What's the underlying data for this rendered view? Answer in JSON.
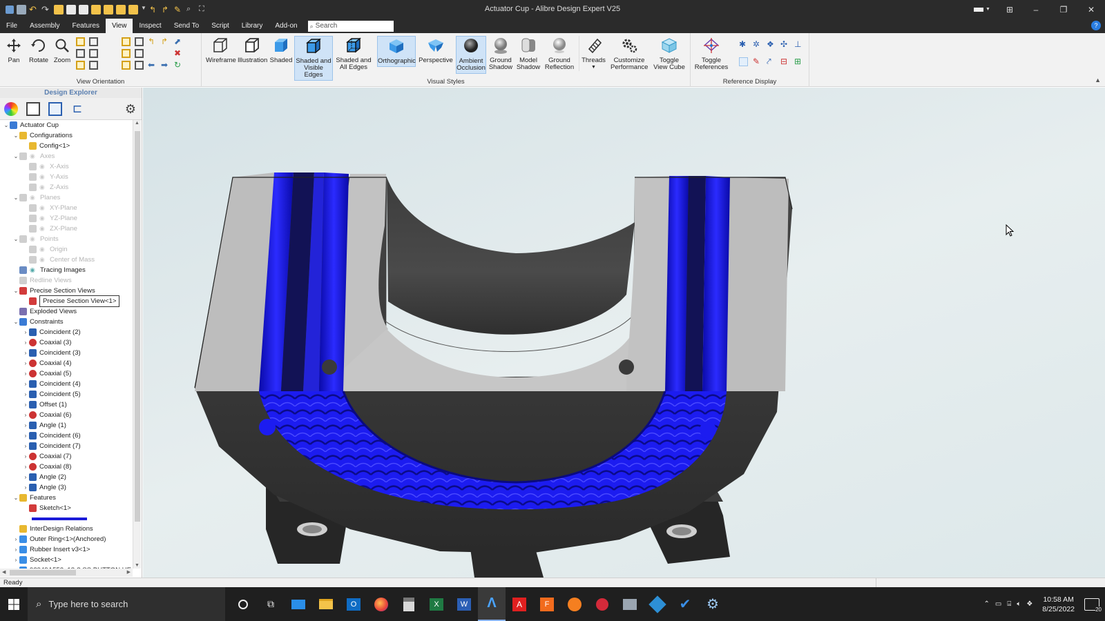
{
  "window": {
    "title": "Actuator Cup - Alibre Design Expert V25",
    "controls": {
      "minimize": "–",
      "restore": "❐",
      "close": "✕"
    }
  },
  "menu": {
    "tabs": [
      "File",
      "Assembly",
      "Features",
      "View",
      "Inspect",
      "Send To",
      "Script",
      "Library",
      "Add-on"
    ],
    "active_tab": "View",
    "search_placeholder": "Search"
  },
  "ribbon": {
    "groups": {
      "view_orientation": "View Orientation",
      "visual_styles": "Visual Styles",
      "reference_display": "Reference Display"
    },
    "buttons": {
      "pan": "Pan",
      "rotate": "Rotate",
      "zoom": "Zoom",
      "wireframe": "Wireframe",
      "illustration": "Illustration",
      "shaded": "Shaded",
      "shaded_visible_edges_1": "Shaded and",
      "shaded_visible_edges_2": "Visible Edges",
      "shaded_all_edges_1": "Shaded and",
      "shaded_all_edges_2": "All Edges",
      "orthographic": "Orthographic",
      "perspective": "Perspective",
      "ambient_occlusion_1": "Ambient",
      "ambient_occlusion_2": "Occlusion",
      "ground_shadow_1": "Ground",
      "ground_shadow_2": "Shadow",
      "model_shadow_1": "Model",
      "model_shadow_2": "Shadow",
      "ground_reflection_1": "Ground",
      "ground_reflection_2": "Reflection",
      "threads": "Threads",
      "customize_performance_1": "Customize",
      "customize_performance_2": "Performance",
      "toggle_view_cube_1": "Toggle",
      "toggle_view_cube_2": "View Cube",
      "toggle_references_1": "Toggle",
      "toggle_references_2": "References"
    }
  },
  "explorer": {
    "title": "Design Explorer",
    "tree": [
      {
        "label": "Actuator Cup",
        "level": 0,
        "expand": "v",
        "icon": "assembly",
        "dim": false
      },
      {
        "label": "Configurations",
        "level": 1,
        "expand": "v",
        "icon": "config",
        "dim": false
      },
      {
        "label": "Config<1>",
        "level": 2,
        "expand": "",
        "icon": "config",
        "dim": false
      },
      {
        "label": "Axes",
        "level": 1,
        "expand": "v",
        "icon": "axis",
        "dim": true,
        "eye": true
      },
      {
        "label": "X-Axis",
        "level": 2,
        "expand": "",
        "icon": "axis",
        "dim": true,
        "eye": true
      },
      {
        "label": "Y-Axis",
        "level": 2,
        "expand": "",
        "icon": "axis",
        "dim": true,
        "eye": true
      },
      {
        "label": "Z-Axis",
        "level": 2,
        "expand": "",
        "icon": "axis",
        "dim": true,
        "eye": true
      },
      {
        "label": "Planes",
        "level": 1,
        "expand": "v",
        "icon": "plane",
        "dim": true,
        "eye": true
      },
      {
        "label": "XY-Plane",
        "level": 2,
        "expand": "",
        "icon": "plane",
        "dim": true,
        "eye": true
      },
      {
        "label": "YZ-Plane",
        "level": 2,
        "expand": "",
        "icon": "plane",
        "dim": true,
        "eye": true
      },
      {
        "label": "ZX-Plane",
        "level": 2,
        "expand": "",
        "icon": "plane",
        "dim": true,
        "eye": true
      },
      {
        "label": "Points",
        "level": 1,
        "expand": "v",
        "icon": "point",
        "dim": true,
        "eye": true
      },
      {
        "label": "Origin",
        "level": 2,
        "expand": "",
        "icon": "point",
        "dim": true,
        "eye": true
      },
      {
        "label": "Center of Mass",
        "level": 2,
        "expand": "",
        "icon": "point",
        "dim": true,
        "eye": true
      },
      {
        "label": "Tracing Images",
        "level": 1,
        "expand": "",
        "icon": "image",
        "dim": false,
        "eye": true
      },
      {
        "label": "Redline Views",
        "level": 1,
        "expand": "",
        "icon": "redline",
        "dim": true
      },
      {
        "label": "Precise Section Views",
        "level": 1,
        "expand": "v",
        "icon": "section",
        "dim": false
      },
      {
        "label": "Precise Section View<1>",
        "level": 2,
        "expand": "",
        "icon": "section",
        "dim": false,
        "editing": true
      },
      {
        "label": "Exploded Views",
        "level": 1,
        "expand": "",
        "icon": "exploded",
        "dim": false
      },
      {
        "label": "Constraints",
        "level": 1,
        "expand": "v",
        "icon": "constraint",
        "dim": false
      },
      {
        "label": "Coincident (2)",
        "level": 2,
        "expand": ">",
        "icon": "coincident",
        "dim": false
      },
      {
        "label": "Coaxial (3)",
        "level": 2,
        "expand": ">",
        "icon": "coaxial",
        "dim": false
      },
      {
        "label": "Coincident (3)",
        "level": 2,
        "expand": ">",
        "icon": "coincident",
        "dim": false
      },
      {
        "label": "Coaxial (4)",
        "level": 2,
        "expand": ">",
        "icon": "coaxial",
        "dim": false
      },
      {
        "label": "Coaxial (5)",
        "level": 2,
        "expand": ">",
        "icon": "coaxial",
        "dim": false
      },
      {
        "label": "Coincident (4)",
        "level": 2,
        "expand": ">",
        "icon": "coincident",
        "dim": false
      },
      {
        "label": "Coincident (5)",
        "level": 2,
        "expand": ">",
        "icon": "coincident",
        "dim": false
      },
      {
        "label": "Offset (1)",
        "level": 2,
        "expand": ">",
        "icon": "offset",
        "dim": false
      },
      {
        "label": "Coaxial (6)",
        "level": 2,
        "expand": ">",
        "icon": "coaxial",
        "dim": false
      },
      {
        "label": "Angle (1)",
        "level": 2,
        "expand": ">",
        "icon": "angle",
        "dim": false
      },
      {
        "label": "Coincident (6)",
        "level": 2,
        "expand": ">",
        "icon": "coincident",
        "dim": false
      },
      {
        "label": "Coincident (7)",
        "level": 2,
        "expand": ">",
        "icon": "coincident",
        "dim": false
      },
      {
        "label": "Coaxial (7)",
        "level": 2,
        "expand": ">",
        "icon": "coaxial",
        "dim": false
      },
      {
        "label": "Coaxial (8)",
        "level": 2,
        "expand": ">",
        "icon": "coaxial",
        "dim": false
      },
      {
        "label": "Angle (2)",
        "level": 2,
        "expand": ">",
        "icon": "angle",
        "dim": false
      },
      {
        "label": "Angle (3)",
        "level": 2,
        "expand": ">",
        "icon": "angle",
        "dim": false
      },
      {
        "label": "Features",
        "level": 1,
        "expand": "v",
        "icon": "features",
        "dim": false
      },
      {
        "label": "Sketch<1>",
        "level": 2,
        "expand": "",
        "icon": "sketch",
        "dim": false
      },
      {
        "label": "",
        "level": 2,
        "expand": "",
        "icon": "rollback",
        "dim": false,
        "rollback": true
      },
      {
        "label": "InterDesign Relations",
        "level": 1,
        "expand": "",
        "icon": "relations",
        "dim": false
      },
      {
        "label": "Outer Ring<1>(Anchored)",
        "level": 1,
        "expand": ">",
        "icon": "part",
        "dim": false
      },
      {
        "label": "Rubber Insert v3<1>",
        "level": 1,
        "expand": ">",
        "icon": "part",
        "dim": false
      },
      {
        "label": "Socket<1>",
        "level": 1,
        "expand": ">",
        "icon": "part",
        "dim": false
      },
      {
        "label": "92949A552_18-8 SS BUTTON HE",
        "level": 1,
        "expand": ">",
        "icon": "part",
        "dim": false
      }
    ]
  },
  "status": {
    "text": "Ready"
  },
  "taskbar": {
    "search_placeholder": "Type here to search",
    "time": "10:58 AM",
    "date": "8/25/2022",
    "notification_count": "20"
  },
  "colors": {
    "accent": "#2a7de1",
    "insert_blue": "#1a1aff",
    "body_dark": "#3a3a3a",
    "section_face": "#b9b9b9"
  }
}
